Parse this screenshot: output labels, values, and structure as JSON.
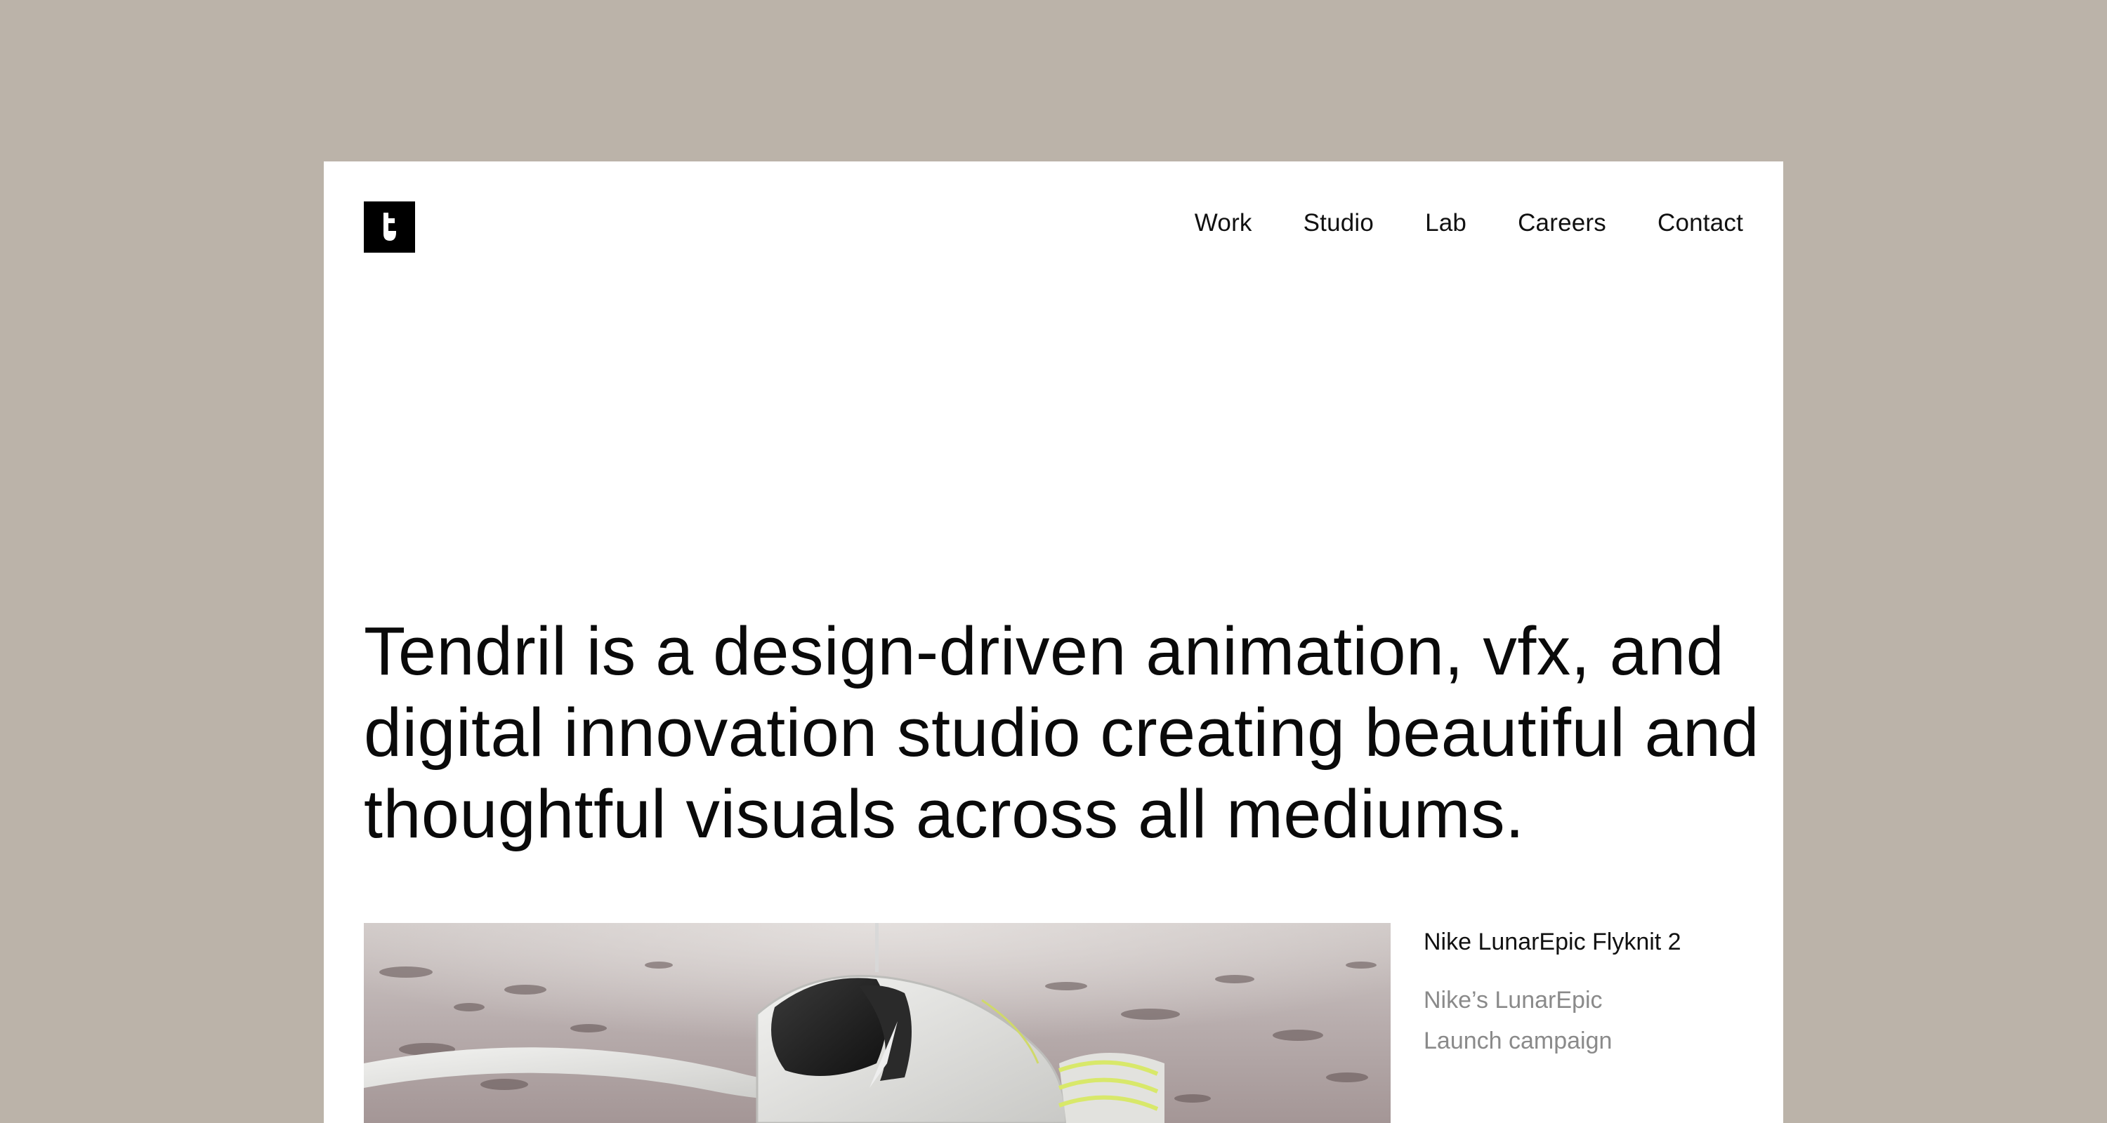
{
  "header": {
    "logo": {
      "icon": "tendril-logo-icon",
      "background": "#000000"
    },
    "nav": [
      {
        "label": "Work"
      },
      {
        "label": "Studio"
      },
      {
        "label": "Lab"
      },
      {
        "label": "Careers"
      },
      {
        "label": "Contact"
      }
    ]
  },
  "hero": {
    "headline": "Tendril is a design-driven animation, vfx, and digital innovation studio creating beautiful and thoughtful visuals across all mediums."
  },
  "featured_project": {
    "title": "Nike LunarEpic Flyknit 2",
    "description_lines": [
      "Nike’s LunarEpic",
      "Launch campaign"
    ],
    "image": {
      "subject": "sneaker-render-on-desert-terrain"
    }
  },
  "colors": {
    "backdrop": "#bbb3a9",
    "page": "#ffffff",
    "text": "#0a0a0a",
    "muted_text": "#8a8a8a",
    "accent_lime": "#d8e86a"
  }
}
